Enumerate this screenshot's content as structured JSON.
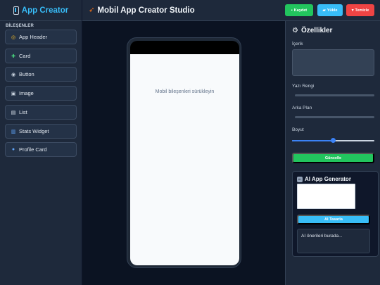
{
  "sidebar": {
    "brand": "App Creator",
    "section_label": "BİLEŞENLER",
    "items": [
      {
        "label": "App Header",
        "icon": "compass-icon"
      },
      {
        "label": "Card",
        "icon": "puzzle-icon"
      },
      {
        "label": "Button",
        "icon": "radio-button-icon"
      },
      {
        "label": "Image",
        "icon": "picture-icon"
      },
      {
        "label": "List",
        "icon": "clipboard-icon"
      },
      {
        "label": "Stats Widget",
        "icon": "bar-chart-icon"
      },
      {
        "label": "Profile Card",
        "icon": "user-icon"
      }
    ]
  },
  "header": {
    "title": "Mobil App Creator Studio",
    "buttons": {
      "save": "Kaydet",
      "load": "Yükle",
      "clear": "Temizle"
    },
    "colors": {
      "save": "#22c55e",
      "load": "#38bdf8",
      "clear": "#ef4444"
    }
  },
  "canvas": {
    "placeholder": "Mobil bileşenleri sürükleyin"
  },
  "properties": {
    "title": "Özellikler",
    "content_label": "İçerik",
    "text_color_label": "Yazı Rengi",
    "background_label": "Arka Plan",
    "size_label": "Boyut",
    "size_value": 0.5,
    "update_button": "Güncelle"
  },
  "ai": {
    "title": "AI App Generator",
    "design_button": "AI Tasarla",
    "output_text": "AI önerileri burada..."
  }
}
